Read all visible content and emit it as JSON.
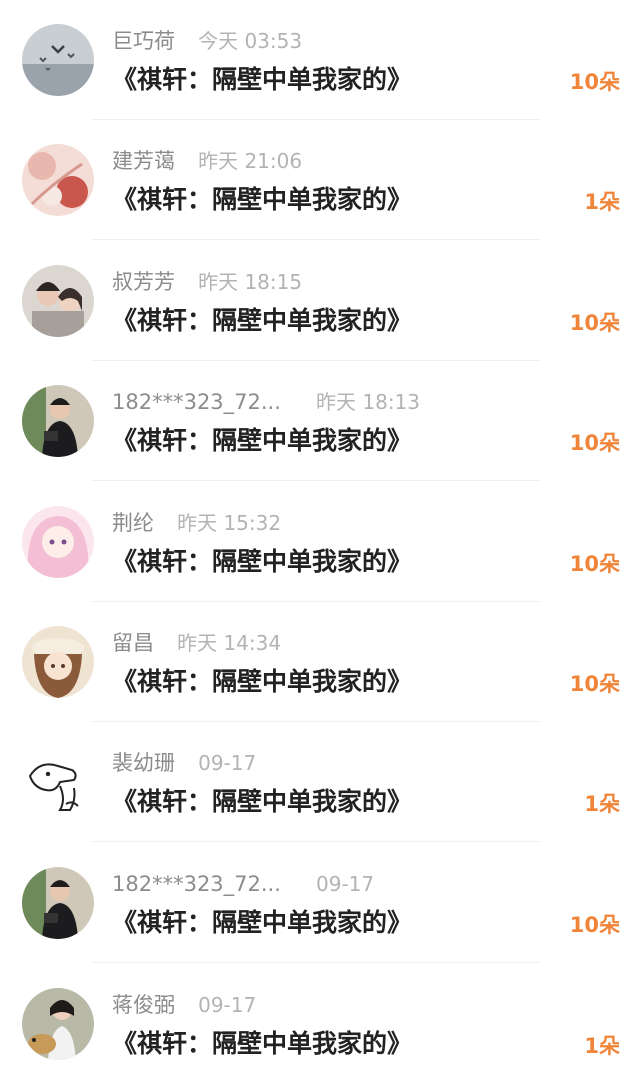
{
  "items": [
    {
      "name": "巨巧荷",
      "time": "今天 03:53",
      "title": "《祺轩：隔壁中单我家的》",
      "gift": "10朵",
      "avatar": "birds-sky-avatar"
    },
    {
      "name": "建芳蔼",
      "time": "昨天 21:06",
      "title": "《祺轩：隔壁中单我家的》",
      "gift": "1朵",
      "avatar": "floral-anime-avatar"
    },
    {
      "name": "叔芳芳",
      "time": "昨天 18:15",
      "title": "《祺轩：隔壁中单我家的》",
      "gift": "10朵",
      "avatar": "couple-photo-avatar"
    },
    {
      "name": "182***323_72...",
      "time": "昨天 18:13",
      "title": "《祺轩：隔壁中单我家的》",
      "gift": "10朵",
      "avatar": "person-camera-avatar"
    },
    {
      "name": "荆纶",
      "time": "昨天 15:32",
      "title": "《祺轩：隔壁中单我家的》",
      "gift": "10朵",
      "avatar": "pink-anime-girl-avatar"
    },
    {
      "name": "留昌",
      "time": "昨天 14:34",
      "title": "《祺轩：隔壁中单我家的》",
      "gift": "10朵",
      "avatar": "anime-girl-hat-avatar"
    },
    {
      "name": "裴幼珊",
      "time": "09-17",
      "title": "《祺轩：隔壁中单我家的》",
      "gift": "1朵",
      "avatar": "sketch-dog-avatar"
    },
    {
      "name": "182***323_72...",
      "time": "09-17",
      "title": "《祺轩：隔壁中单我家的》",
      "gift": "10朵",
      "avatar": "person-camera-avatar"
    },
    {
      "name": "蒋俊弼",
      "time": "09-17",
      "title": "《祺轩：隔壁中单我家的》",
      "gift": "1朵",
      "avatar": "person-with-dog-avatar"
    }
  ],
  "colors": {
    "gift": "#f0853a",
    "title": "#222222",
    "name": "#8c8c8c",
    "time": "#b3b3b3"
  }
}
